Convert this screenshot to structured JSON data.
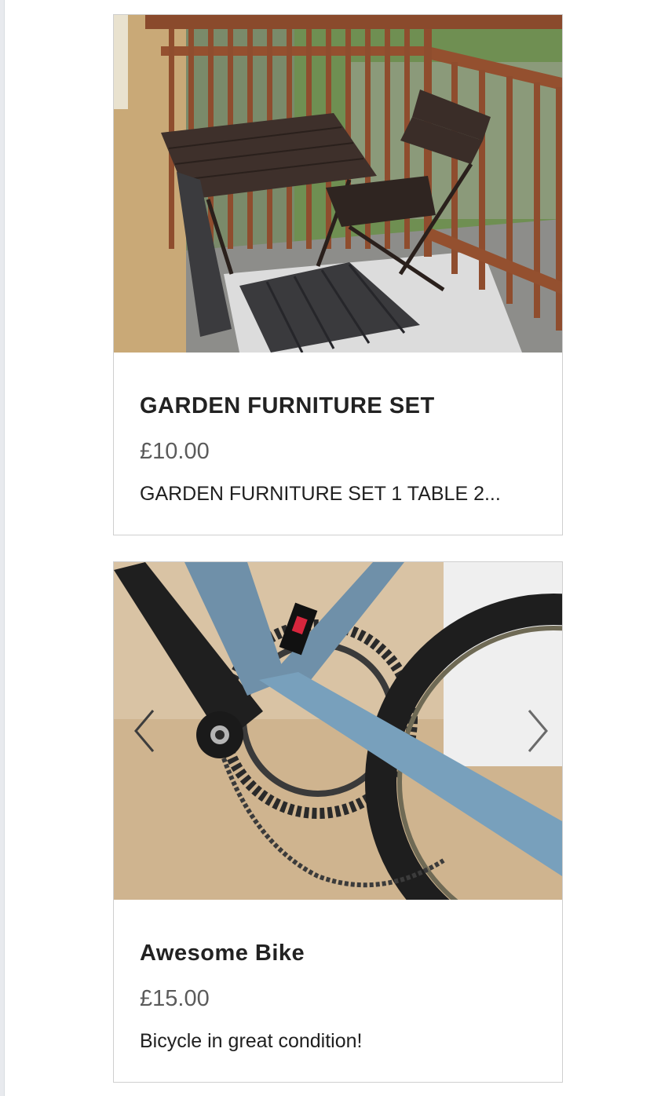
{
  "listings": [
    {
      "title": "GARDEN FURNITURE SET",
      "price": "£10.00",
      "description": "GARDEN FURNITURE SET 1 TABLE 2...",
      "image_alt": "Balcony with wooden table and two folding chairs"
    },
    {
      "title": "Awesome Bike",
      "price": "£15.00",
      "description": "Bicycle in great condition!",
      "image_alt": "Close-up of a blue bicycle frame and chainring"
    }
  ],
  "carousel": {
    "prev_icon": "chevron-left-icon",
    "next_icon": "chevron-right-icon"
  },
  "colors": {
    "card_border": "#cfcfcf",
    "title": "#222222",
    "price": "#5b5b5b"
  }
}
